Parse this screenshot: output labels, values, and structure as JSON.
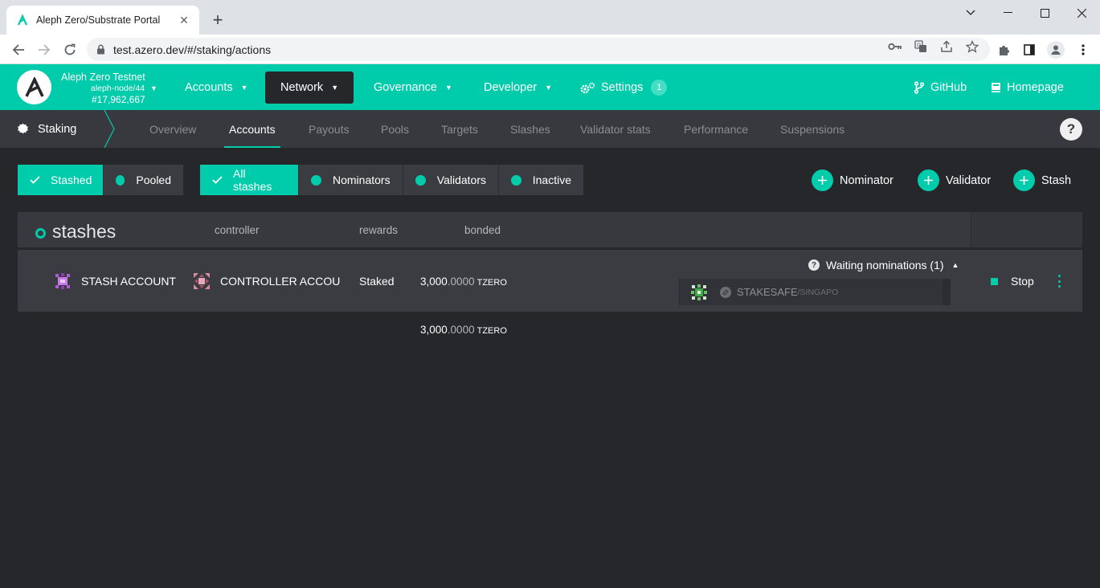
{
  "browser": {
    "tab_title": "Aleph Zero/Substrate Portal",
    "url": "test.azero.dev/#/staking/actions"
  },
  "header": {
    "chain_name": "Aleph Zero Testnet",
    "node": "aleph-node/44",
    "block": "#17,962,667",
    "menu": [
      {
        "label": "Accounts"
      },
      {
        "label": "Network"
      },
      {
        "label": "Governance"
      },
      {
        "label": "Developer"
      },
      {
        "label": "Settings",
        "badge": "1"
      }
    ],
    "links": [
      {
        "label": "GitHub"
      },
      {
        "label": "Homepage"
      }
    ]
  },
  "subnav": {
    "section": "Staking",
    "tabs": [
      "Overview",
      "Accounts",
      "Payouts",
      "Pools",
      "Targets",
      "Slashes",
      "Validator stats",
      "Performance",
      "Suspensions"
    ],
    "active_tab": "Accounts"
  },
  "filters": {
    "type": [
      "Stashed",
      "Pooled"
    ],
    "stash": [
      "All stashes",
      "Nominators",
      "Validators",
      "Inactive"
    ]
  },
  "actions": [
    "Nominator",
    "Validator",
    "Stash"
  ],
  "table": {
    "title": "stashes",
    "columns": [
      "controller",
      "rewards",
      "bonded"
    ],
    "rows": [
      {
        "stash": "STASH ACCOUNT",
        "controller": "CONTROLLER ACCOU",
        "rewards": "Staked",
        "bonded_int": "3,000",
        "bonded_dec": ".0000",
        "unit": "TZERO",
        "waiting_label": "Waiting nominations (1)",
        "nominee_name": "STAKESAFE",
        "nominee_sub": "/SINGAPO",
        "action": "Stop"
      }
    ],
    "total_int": "3,000",
    "total_dec": ".0000",
    "total_unit": "TZERO"
  },
  "colors": {
    "accent": "#00ccab",
    "background": "#26272b",
    "panel": "#3b3c42"
  }
}
